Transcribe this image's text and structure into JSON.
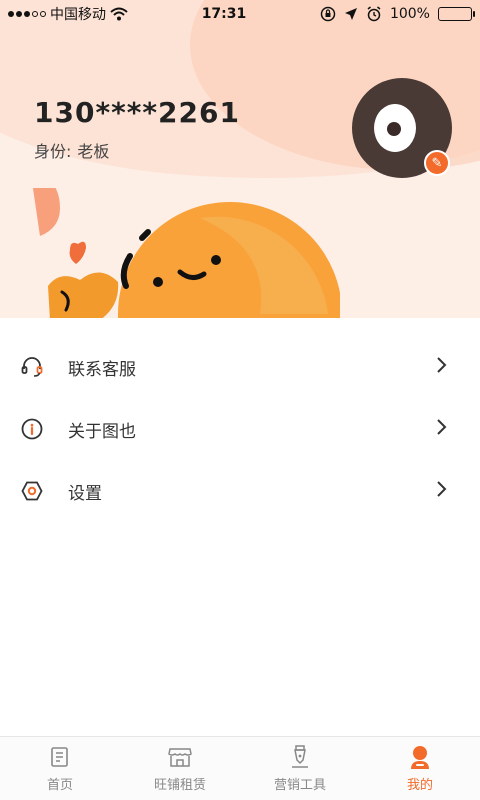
{
  "status_bar": {
    "carrier": "中国移动",
    "time": "17:31",
    "battery": "100%"
  },
  "profile": {
    "phone": "130****2261",
    "role_label": "身份:",
    "role_value": "老板"
  },
  "menu": {
    "items": [
      {
        "label": "联系客服",
        "icon": "headset-icon"
      },
      {
        "label": "关于图也",
        "icon": "info-icon"
      },
      {
        "label": "设置",
        "icon": "settings-icon"
      }
    ]
  },
  "tabbar": {
    "tabs": [
      {
        "label": "首页",
        "icon": "home-icon",
        "active": false
      },
      {
        "label": "旺铺租赁",
        "icon": "shop-icon",
        "active": false
      },
      {
        "label": "营销工具",
        "icon": "pen-icon",
        "active": false
      },
      {
        "label": "我的",
        "icon": "user-icon",
        "active": true
      }
    ]
  },
  "colors": {
    "accent": "#f26b2a",
    "header_bg": "#fdeee6",
    "mascot": "#f9a23a"
  }
}
